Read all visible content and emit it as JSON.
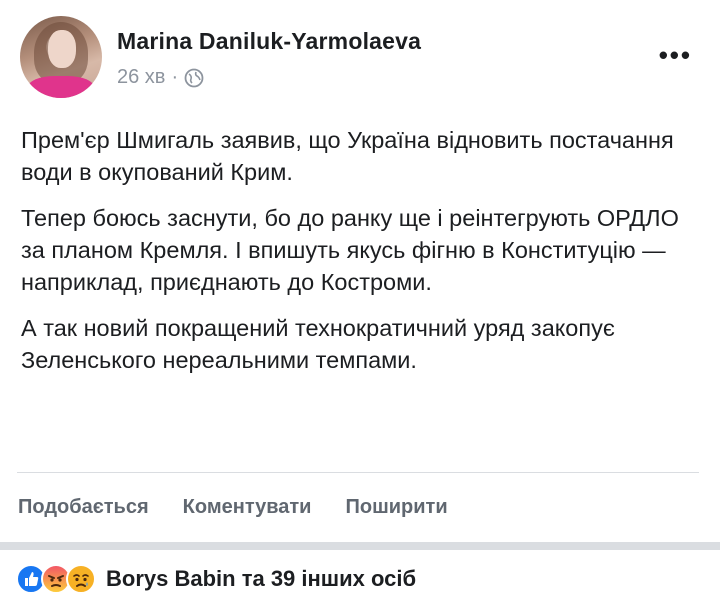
{
  "post": {
    "author": "Marina Daniluk-Yarmolaeva",
    "time": "26 хв",
    "dot": "·",
    "more": "•••",
    "paragraphs": [
      "Прем'єр Шмигаль заявив, що Україна відновить постачання води в окупований Крим.",
      "Тепер боюсь заснути, бо до ранку ще і реінтегрують ОРДЛО за планом Кремля. І впишуть якусь фігню в Конституцію — наприклад, приєднають до Костроми.",
      "А так новий покращений технократичний уряд закопує Зеленського нереальними темпами."
    ]
  },
  "actions": {
    "like": "Подобається",
    "comment": "Коментувати",
    "share": "Поширити"
  },
  "reactions": {
    "icons": [
      "like-icon",
      "angry-icon",
      "sad-icon"
    ],
    "summary": "Borys Babin та 39 інших осіб"
  },
  "colors": {
    "like": "#1877f2",
    "angry": "#f25268",
    "sad": "#f7b125",
    "muted": "#606770",
    "divider": "#dadde1"
  }
}
